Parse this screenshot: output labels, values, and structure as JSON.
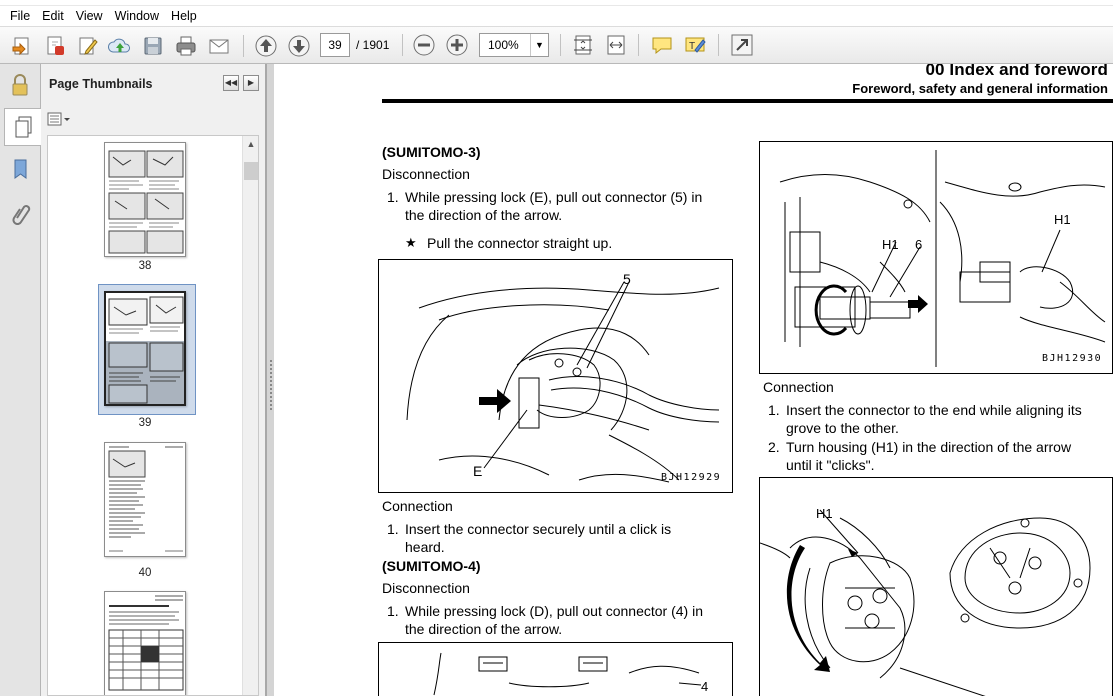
{
  "menu": {
    "file": "File",
    "edit": "Edit",
    "view": "View",
    "window": "Window",
    "help": "Help"
  },
  "toolbar": {
    "page_current": "39",
    "page_total": "/ 1901",
    "zoom": "100%"
  },
  "thumbnails": {
    "title": "Page Thumbnails",
    "pages": [
      {
        "label": "38"
      },
      {
        "label": "39"
      },
      {
        "label": "40"
      }
    ]
  },
  "document": {
    "header_title": "00 Index and foreword",
    "header_subtitle": "Foreword, safety and general information",
    "left": {
      "sumitomo3": "(SUMITOMO-3)",
      "disc1": "Disconnection",
      "step1_num": "1.",
      "step1_a": "While pressing lock (E), pull out connector (5) in",
      "step1_b": "the direction of the arrow.",
      "star": "★",
      "star_text": "Pull the connector straight up.",
      "fig1_code": "BJH12929",
      "fig1_label_5": "5",
      "fig1_label_e": "E",
      "conn1": "Connection",
      "cstep1_num": "1.",
      "cstep1_a": "Insert the connector securely until a click is",
      "cstep1_b": "heard.",
      "sumitomo4": "(SUMITOMO-4)",
      "disc2": "Disconnection",
      "step2_num": "1.",
      "step2_a": "While pressing lock (D), pull out connector (4) in",
      "step2_b": "the direction of the arrow.",
      "fig3_label_4": "4"
    },
    "right": {
      "fig2_code": "BJH12930",
      "fig2_h1a": "H1",
      "fig2_6": "6",
      "fig2_h1b": "H1",
      "conn": "Connection",
      "s1_num": "1.",
      "s1_a": "Insert the connector to the end while aligning its",
      "s1_b": "grove to the other.",
      "s2_num": "2.",
      "s2_a": "Turn housing (H1) in the direction of the arrow",
      "s2_b": "until it \"clicks\".",
      "fig4_h1": "H1"
    }
  }
}
